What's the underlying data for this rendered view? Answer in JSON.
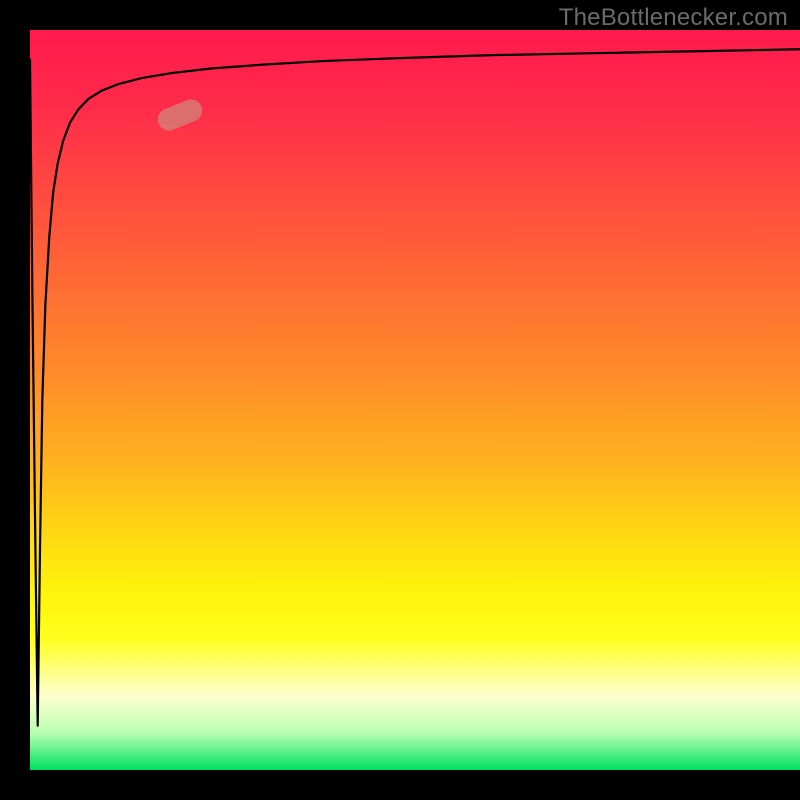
{
  "attribution": "TheBottlenecker.com",
  "chart_data": {
    "type": "line",
    "title": "",
    "xlabel": "",
    "ylabel": "",
    "xlim": [
      0,
      100
    ],
    "ylim": [
      0,
      100
    ],
    "series": [
      {
        "name": "curve",
        "x": [
          0,
          0.3,
          0.7,
          1.0,
          1.3,
          1.6,
          2.0,
          2.5,
          3.0,
          3.6,
          4.3,
          5.2,
          6.3,
          7.6,
          9.3,
          11.5,
          14.5,
          18.5,
          23.5,
          30,
          38,
          48,
          60,
          75,
          90,
          100
        ],
        "values": [
          96,
          65,
          30,
          6,
          30,
          50,
          63,
          72,
          78,
          82,
          85,
          87.5,
          89.3,
          90.7,
          91.8,
          92.7,
          93.5,
          94.2,
          94.8,
          95.3,
          95.8,
          96.2,
          96.6,
          96.9,
          97.2,
          97.4
        ],
        "note": "Values estimated from visual curve; y scale 0 at bottom (green) to 100 at top (red)."
      }
    ],
    "marker": {
      "x_pct": 19.5,
      "y_pct": 88.5,
      "angle_deg": -22
    },
    "gradient_stops": [
      {
        "pct": 0,
        "color": "#ff1a4d"
      },
      {
        "pct": 50,
        "color": "#ff9a24"
      },
      {
        "pct": 80,
        "color": "#ffff19"
      },
      {
        "pct": 100,
        "color": "#00e060"
      }
    ]
  }
}
